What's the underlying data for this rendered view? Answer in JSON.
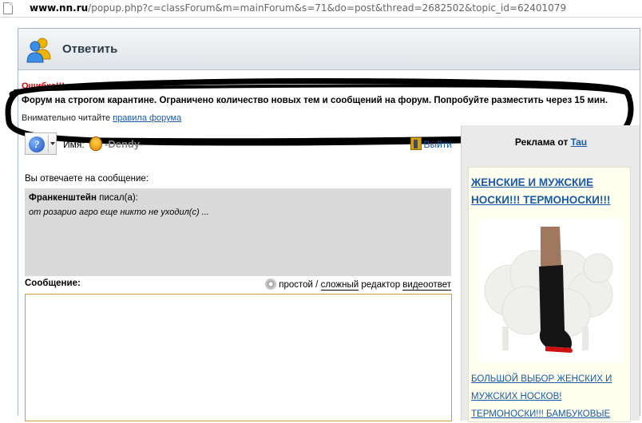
{
  "address_bar": {
    "host": "www.nn.ru",
    "path": "/popup.php?c=classForum&m=mainForum&s=71&do=post&thread=2682502&topic_id=62401079"
  },
  "window": {
    "title": "Ответить"
  },
  "error": {
    "title": "Ошибка!!!",
    "message": "Форум на строгом карантине. Ограничено количество новых тем и сообщений на форум. Попробуйте разместить через 15 мин.",
    "note_prefix": "Внимательно читайте",
    "note_link": "правила форума"
  },
  "toolbar": {
    "help_glyph": "?",
    "name_label": "Имя:",
    "user_name": "-Dendy-",
    "logout_label": "Выйти"
  },
  "reply": {
    "label": "Вы отвечаете на сообщение:",
    "quote_author": "Франкенштейн",
    "quote_suffix": " писал(а):",
    "quote_text": "от розарио агро еще никто не уходил(с) ..."
  },
  "editor": {
    "message_label": "Сообщение:",
    "simple": "простой",
    "separator": " / ",
    "complex": "сложный",
    "editor_word": " редактор ",
    "video_reply": "видеоответ",
    "message_value": ""
  },
  "ad": {
    "header_prefix": "Реклама от",
    "header_link": "Tau",
    "title": "ЖЕНСКИЕ И МУЖСКИЕ НОСКИ!!! ТЕРМОНОСКИ!!!",
    "text": "БОЛЬШОЙ ВЫБОР ЖЕНСКИХ И МУЖСКИХ НОСКОВ! ТЕРМОНОСКИ!!! БАМБУКОВЫЕ"
  },
  "colors": {
    "error_red": "#e00000",
    "link_blue": "#1a5aa8",
    "quote_bg": "#dadada",
    "ad_bg": "#fffff0",
    "textarea_border": "#d49a3a"
  }
}
